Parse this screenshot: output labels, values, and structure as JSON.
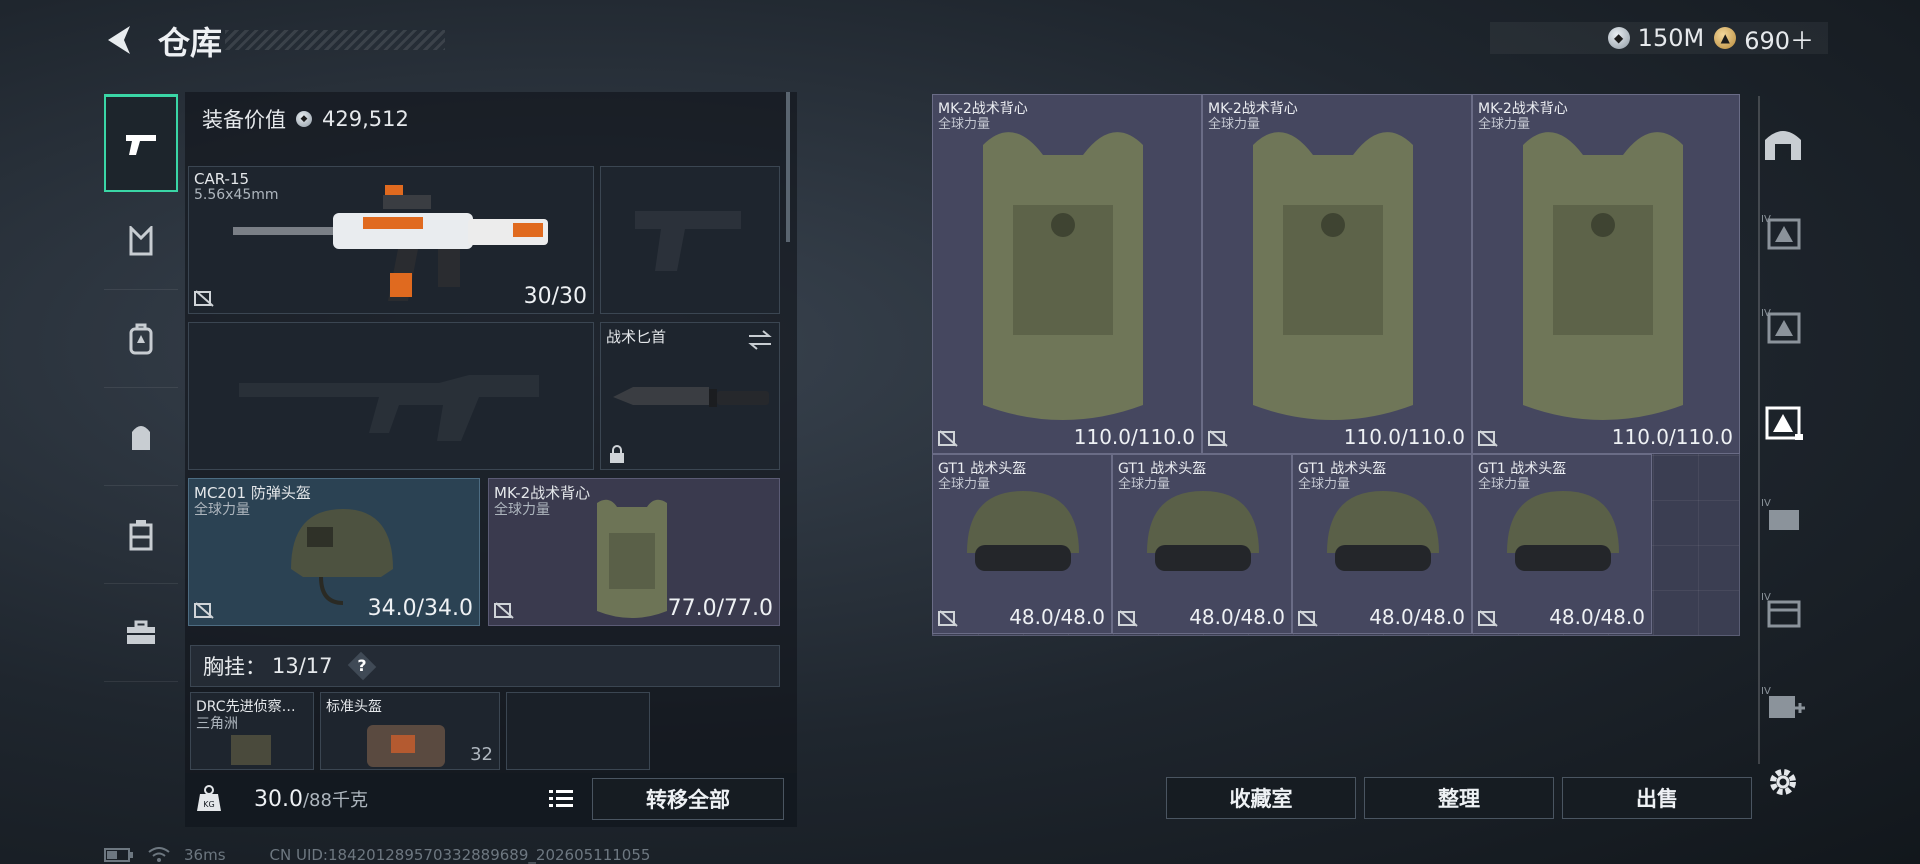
{
  "header": {
    "title": "仓库",
    "currencies": [
      {
        "icon": "silver-coin-icon",
        "value": "150M"
      },
      {
        "icon": "gold-coin-icon",
        "value": "690＋"
      }
    ]
  },
  "left_rail": {
    "tabs": [
      {
        "icon": "pistol-icon",
        "active": true
      },
      {
        "icon": "chest-rig-icon",
        "active": false
      },
      {
        "icon": "backpack-icon",
        "active": false
      },
      {
        "icon": "pouch-icon",
        "active": false
      },
      {
        "icon": "safe-box-icon",
        "active": false
      },
      {
        "icon": "toolbox-icon",
        "active": false
      }
    ]
  },
  "equipment": {
    "value_label": "装备价值",
    "value": "429,512",
    "primary_weapon": {
      "name": "CAR-15",
      "caliber": "5.56x45mm",
      "ammo": "30/30"
    },
    "melee": {
      "name": "战术匕首"
    },
    "helmet": {
      "name": "MC201 防弹头盔",
      "brand": "全球力量",
      "durability": "34.0/34.0"
    },
    "armor": {
      "name": "MK-2战术背心",
      "brand": "全球力量",
      "durability": "77.0/77.0"
    },
    "chest_rig": {
      "label": "胸挂：",
      "capacity": "13/17",
      "help": "?"
    },
    "rig_items": [
      {
        "name": "DRC先进侦察…",
        "brand": "三角洲"
      },
      {
        "name": "标准头盔",
        "count": "32"
      }
    ],
    "weight": {
      "current": "30.0",
      "max": "/88千克"
    },
    "transfer_all": "转移全部"
  },
  "stash": {
    "armors": [
      {
        "name": "MK-2战术背心",
        "brand": "全球力量",
        "durability": "110.0/110.0"
      },
      {
        "name": "MK-2战术背心",
        "brand": "全球力量",
        "durability": "110.0/110.0"
      },
      {
        "name": "MK-2战术背心",
        "brand": "全球力量",
        "durability": "110.0/110.0"
      }
    ],
    "helmets": [
      {
        "name": "GT1 战术头盔",
        "brand": "全球力量",
        "durability": "48.0/48.0"
      },
      {
        "name": "GT1 战术头盔",
        "brand": "全球力量",
        "durability": "48.0/48.0"
      },
      {
        "name": "GT1 战术头盔",
        "brand": "全球力量",
        "durability": "48.0/48.0"
      },
      {
        "name": "GT1 战术头盔",
        "brand": "全球力量",
        "durability": "48.0/48.0"
      }
    ],
    "buttons": {
      "collection": "收藏室",
      "organize": "整理",
      "sell": "出售"
    }
  },
  "right_rail": {
    "items": [
      {
        "icon": "stash-gate-icon",
        "tier": ""
      },
      {
        "icon": "armor-filter-icon",
        "tier": "IV"
      },
      {
        "icon": "armor-filter-icon",
        "tier": "IV"
      },
      {
        "icon": "armor-filter-icon",
        "tier": ""
      },
      {
        "icon": "armor-filter-icon",
        "tier": "IV"
      },
      {
        "icon": "armor-filter-icon",
        "tier": "IV"
      },
      {
        "icon": "armor-filter-icon",
        "tier": "IV"
      }
    ],
    "settings_icon": "gear-icon"
  },
  "status": {
    "ping": "36ms",
    "uid": "CN UID:18420128957033288968​9_202605111055"
  },
  "colors": {
    "accent": "#3ad6a6",
    "blue_rarity": "#2b4253",
    "purple_rarity": "#45475f"
  }
}
